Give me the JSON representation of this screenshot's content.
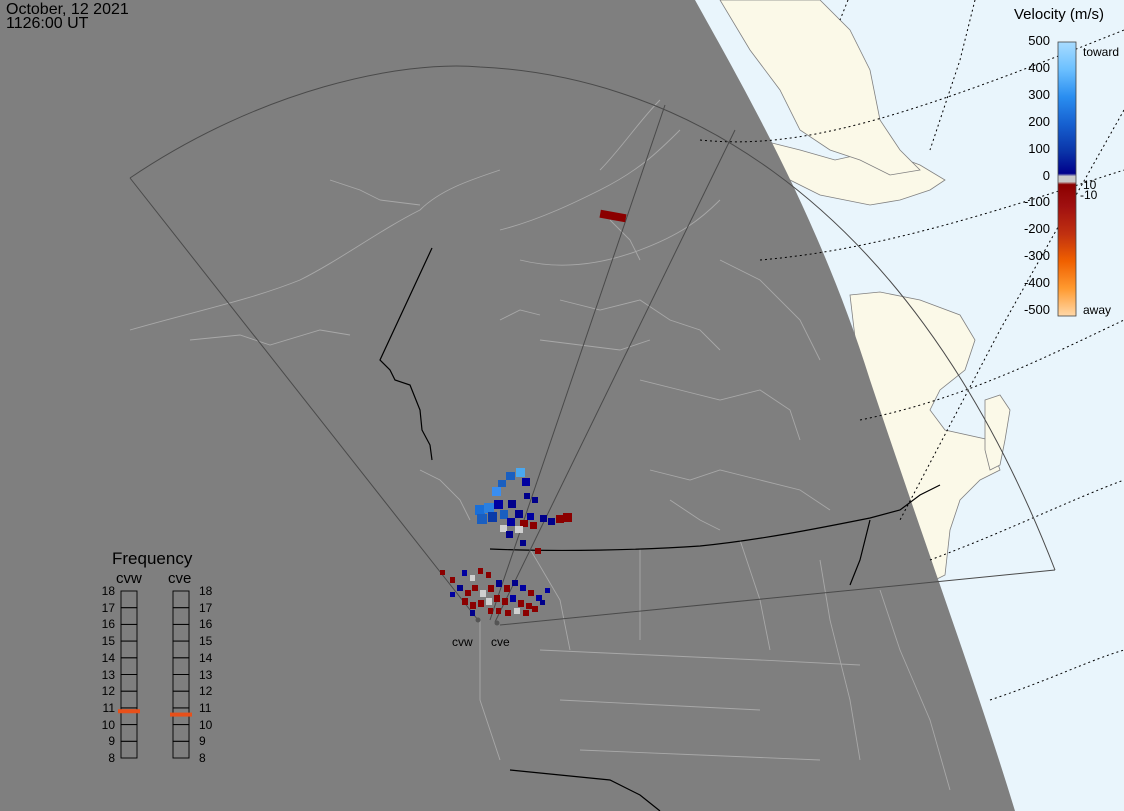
{
  "header": {
    "date": "October, 12 2021",
    "time": "1126:00 UT"
  },
  "colorbar": {
    "title": "Velocity (m/s)",
    "ticks": [
      "500",
      "400",
      "300",
      "200",
      "100",
      "0",
      "-100",
      "-200",
      "-300",
      "-400",
      "-500"
    ],
    "inner_labels": [
      "10",
      "-10"
    ],
    "toward_label": "toward",
    "away_label": "away"
  },
  "frequency_panel": {
    "title": "Frequency",
    "radars": [
      {
        "code": "cvw",
        "mhz": 10.8
      },
      {
        "code": "cve",
        "mhz": 10.6
      }
    ],
    "ticks": [
      "18",
      "17",
      "16",
      "15",
      "14",
      "13",
      "12",
      "11",
      "10",
      "9",
      "8"
    ]
  },
  "radar_labels": {
    "west": "cvw",
    "east": "cve"
  },
  "colors": {
    "night_shade": "#7f7f7f",
    "ocean": "#e9f5fc",
    "land": "#fbf9e8",
    "toward_strong": "#00008b",
    "away_strong": "#8b0000",
    "frequency_marker": "#e8501a"
  }
}
